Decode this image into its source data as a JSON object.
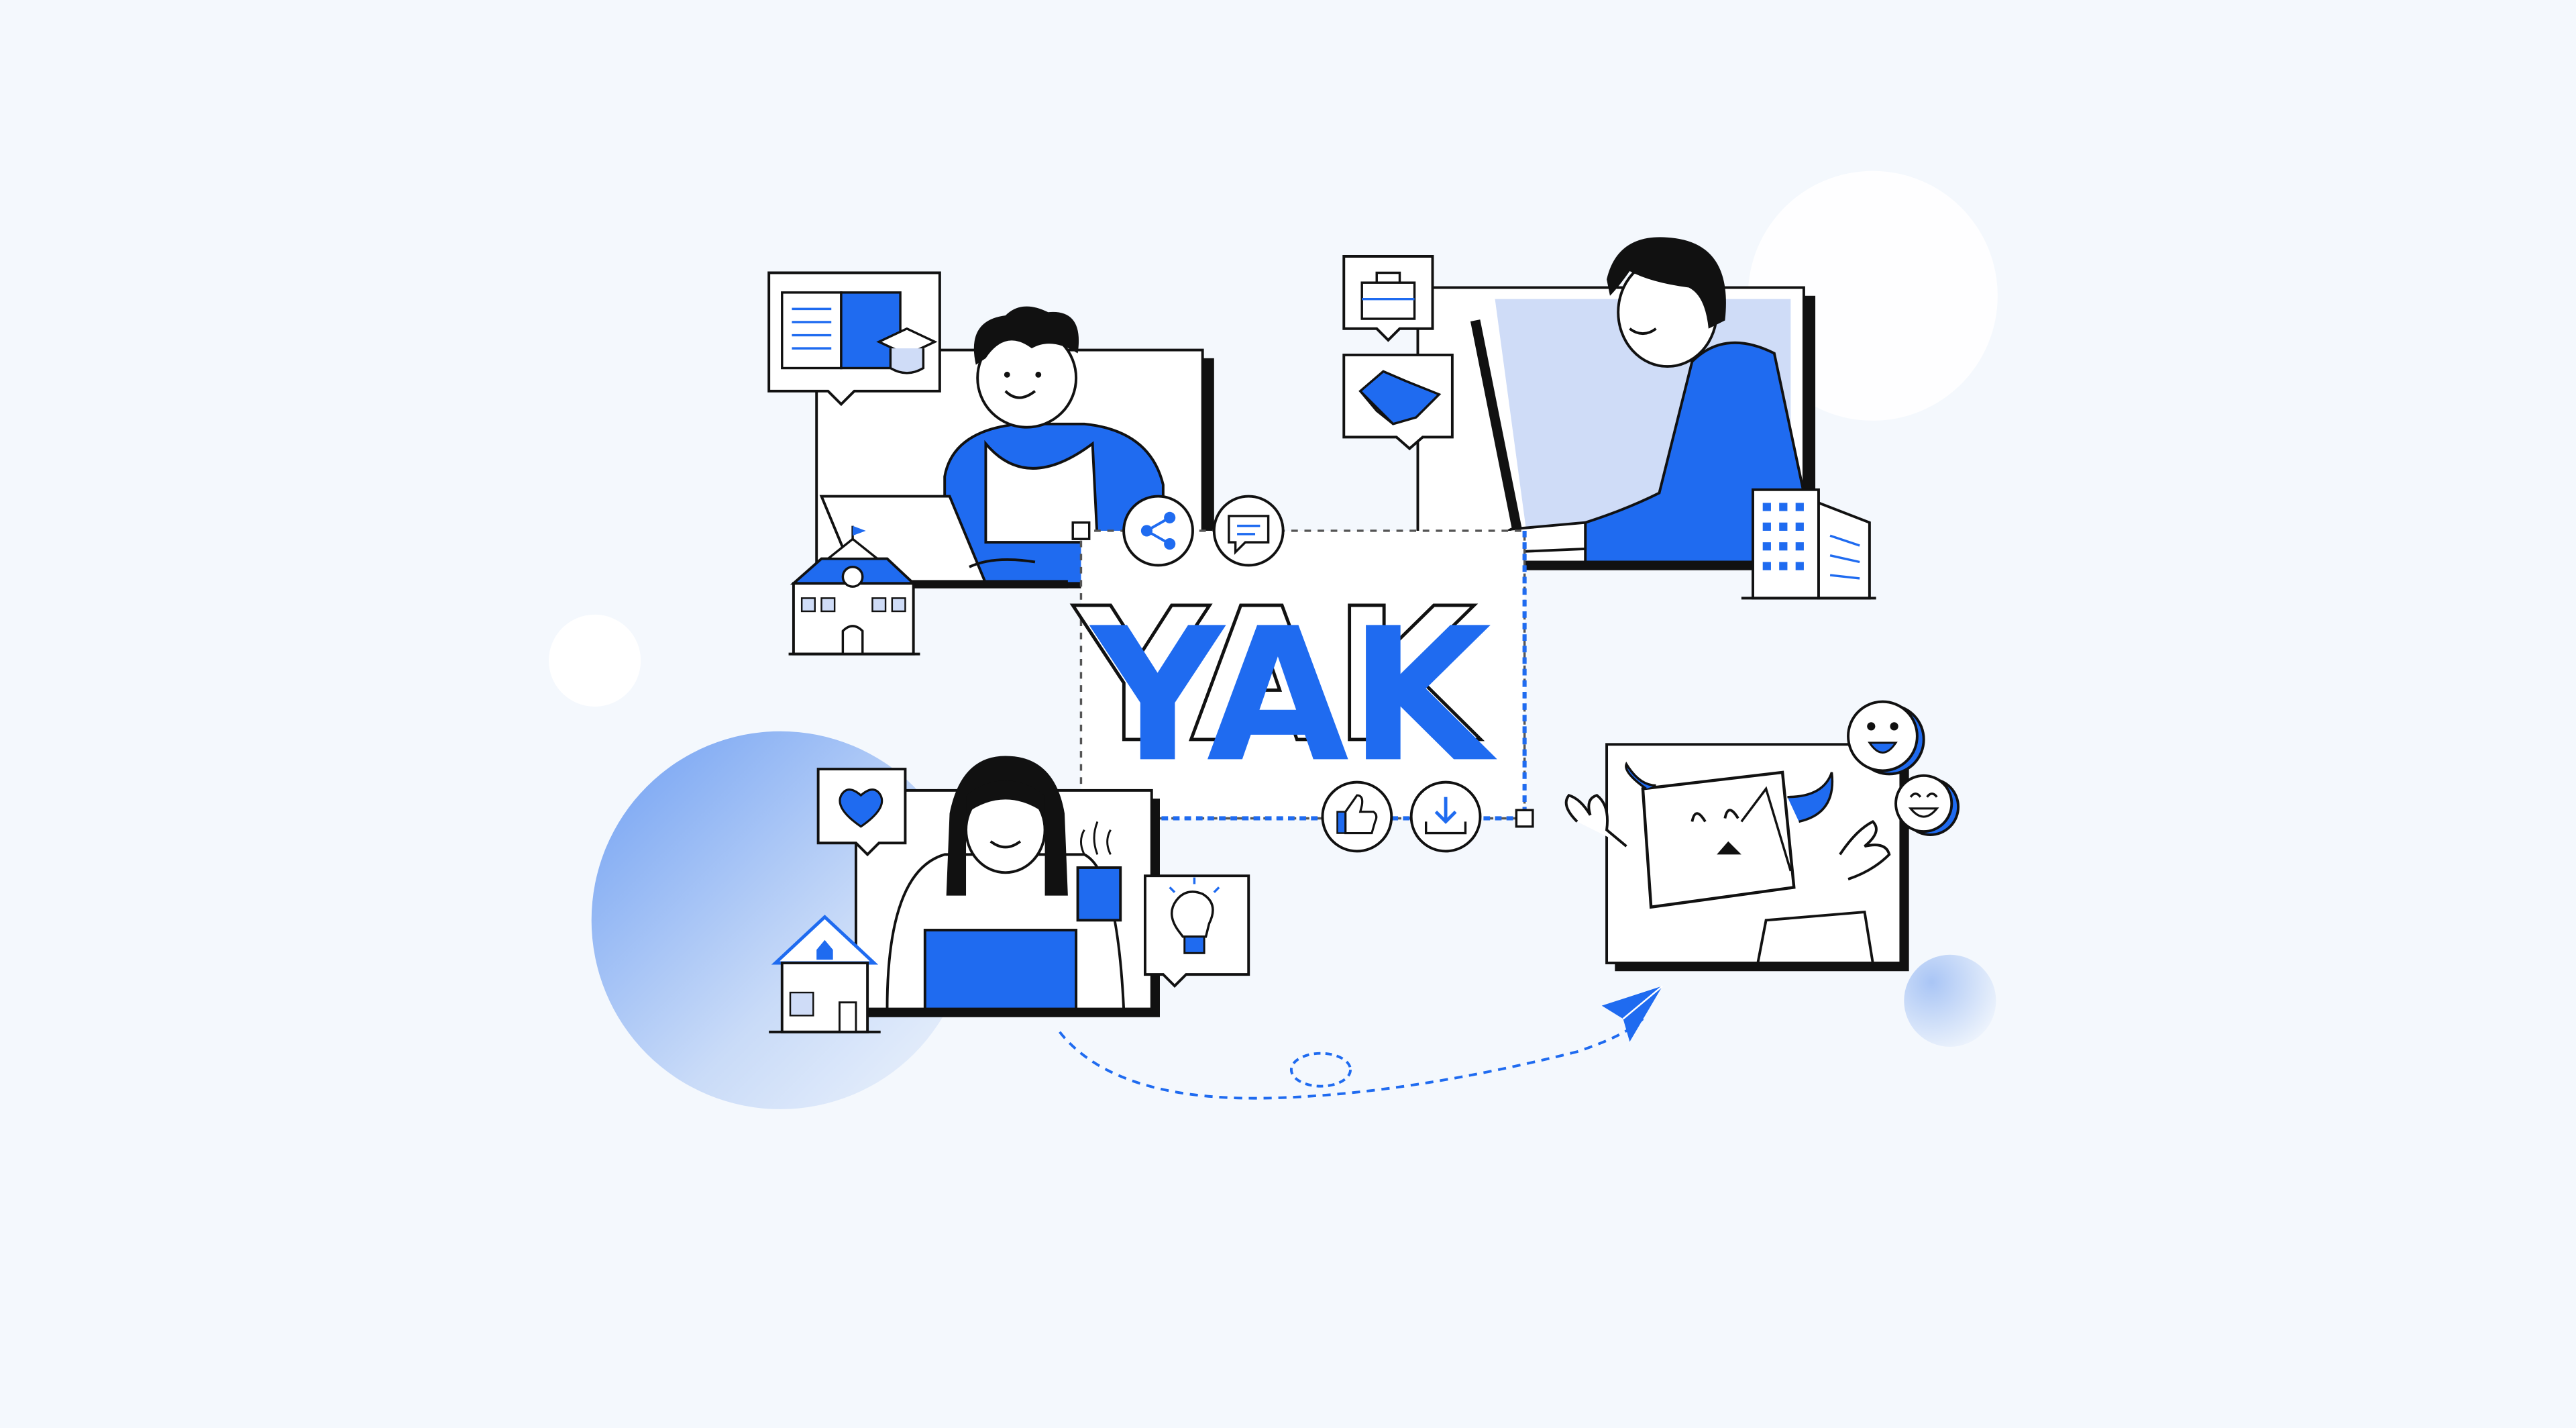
{
  "brand": {
    "logo_text": "YAK"
  },
  "colors": {
    "background": "#f4f8fd",
    "accent": "#1f6bf0",
    "accent_light": "#cfdcf7",
    "ink": "#111111",
    "white": "#ffffff"
  },
  "icons": [
    "open-book-icon",
    "graduation-cap-icon",
    "school-building-icon",
    "briefcase-icon",
    "handshake-icon",
    "office-building-icon",
    "share-icon",
    "chat-bubble-icon",
    "thumbs-up-icon",
    "download-icon",
    "heart-icon",
    "lightbulb-icon",
    "house-icon",
    "paper-plane-icon",
    "smiley-face-icon",
    "laughing-face-icon"
  ]
}
